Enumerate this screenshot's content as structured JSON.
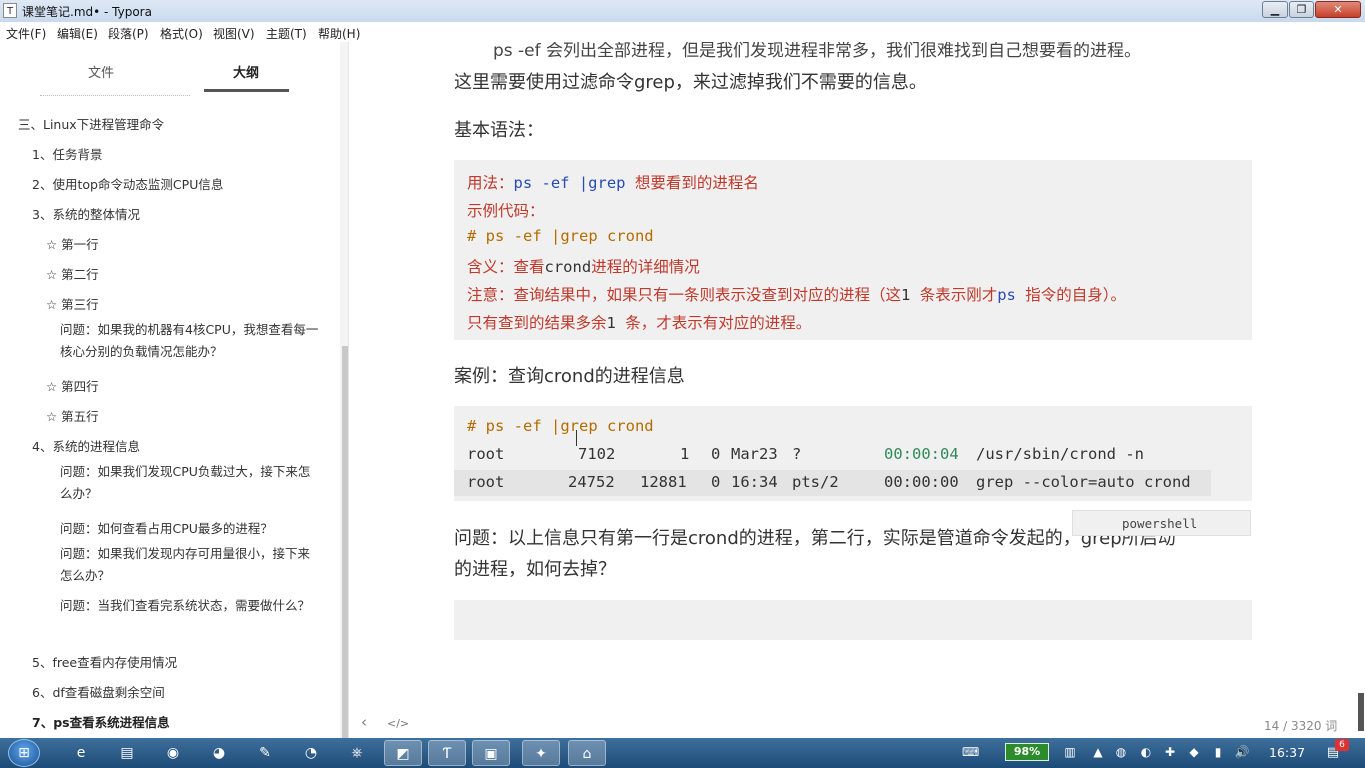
{
  "window": {
    "title": "课堂笔记.md• - Typora",
    "title_icon": "T",
    "buttons": {
      "minimize": "▁",
      "maximize": "❐",
      "close": "✕"
    }
  },
  "menubar": [
    "文件(F)",
    "编辑(E)",
    "段落(P)",
    "格式(O)",
    "视图(V)",
    "主题(T)",
    "帮助(H)"
  ],
  "sidebar": {
    "tabs": {
      "files": "文件",
      "outline": "大纲"
    },
    "outline": [
      "三、Linux下进程管理命令",
      "1、任务背景",
      "2、使用top命令动态监测CPU信息",
      "3、系统的整体情况",
      "☆ 第一行",
      "☆ 第二行",
      "☆ 第三行",
      "问题：如果我的机器有4核CPU，我想查看每一核心分别的负载情况怎能办？",
      "☆ 第四行",
      "☆ 第五行",
      "4、系统的进程信息",
      "问题：如果我们发现CPU负载过大，接下来怎么办？",
      "问题：如何查看占用CPU最多的进程？",
      "问题：如果我们发现内存可用量很小，接下来怎么办？",
      "问题：当我们查看完系统状态，需要做什么？",
      "5、free查看内存使用情况",
      "6、df查看磁盘剩余空间",
      "7、ps查看系统进程信息"
    ]
  },
  "content": {
    "para_top_partial": "ps -ef 会列出全部进程，但是我们发现进程非常多，我们很难找到自己想要看的进程。",
    "para_grep": "这里需要使用过滤命令grep，来过滤掉我们不需要的信息。",
    "basic_syntax": "基本语法：",
    "syntax_block": {
      "l1_a": "用法：",
      "l1_b": "ps -ef |grep",
      "l1_c": " 想要看到的进程名",
      "l2": "示例代码：",
      "l3": "# ps -ef |grep crond",
      "l4_a": "含义：查看",
      "l4_b": "crond",
      "l4_c": "进程的详细情况",
      "l5_a": "注意：查询结果中，如果只有一条则表示没查到对应的进程（这",
      "l5_b": "1",
      "l5_c": " 条表示刚才",
      "l5_d": "ps",
      "l5_e": " 指令的自身）。",
      "l6_a": "只有查到的结果多余",
      "l6_b": "1",
      "l6_c": " 条，才表示有对应的进程。"
    },
    "case_title": "案例：查询crond的进程信息",
    "case_block": {
      "cmd": "# ps -ef |grep crond",
      "row1": {
        "user": "root",
        "pid": "7102",
        "ppid": "1",
        "c": "0",
        "stime": "Mar23",
        "tty": "?",
        "time": "00:00:04",
        "cmd_a": "/usr/sbin/",
        "cmd_b": "crond",
        "cmd_c": " -n"
      },
      "row2": {
        "user": "root",
        "pid": "24752",
        "ppid": "12881",
        "c": "0",
        "stime": "16:34",
        "tty": "pts/2",
        "time": "00:00:00",
        "cmd": "grep --color=auto crond"
      },
      "language": "powershell"
    },
    "question_line1": "问题：以上信息只有第一行是crond的进程，第二行，实际是管道命令发起的，grep所启动",
    "question_line2": "的进程，如何去掉？"
  },
  "footer": {
    "back": "‹",
    "source": "</>",
    "word_count": "14 / 3320 词"
  },
  "taskbar": {
    "start": "⊞",
    "apps": [
      "e",
      "▤",
      "◉",
      "◕",
      "✎",
      "◔",
      "⎈",
      "◩",
      "Ƭ",
      "▣",
      "✦",
      "⌂"
    ],
    "battery": "98%",
    "tray": [
      "⌨",
      "▥",
      "▲",
      "◍",
      "◐",
      "✚",
      "◆",
      "▮",
      "🔊"
    ],
    "clock": "16:37",
    "notification_count": "6"
  }
}
